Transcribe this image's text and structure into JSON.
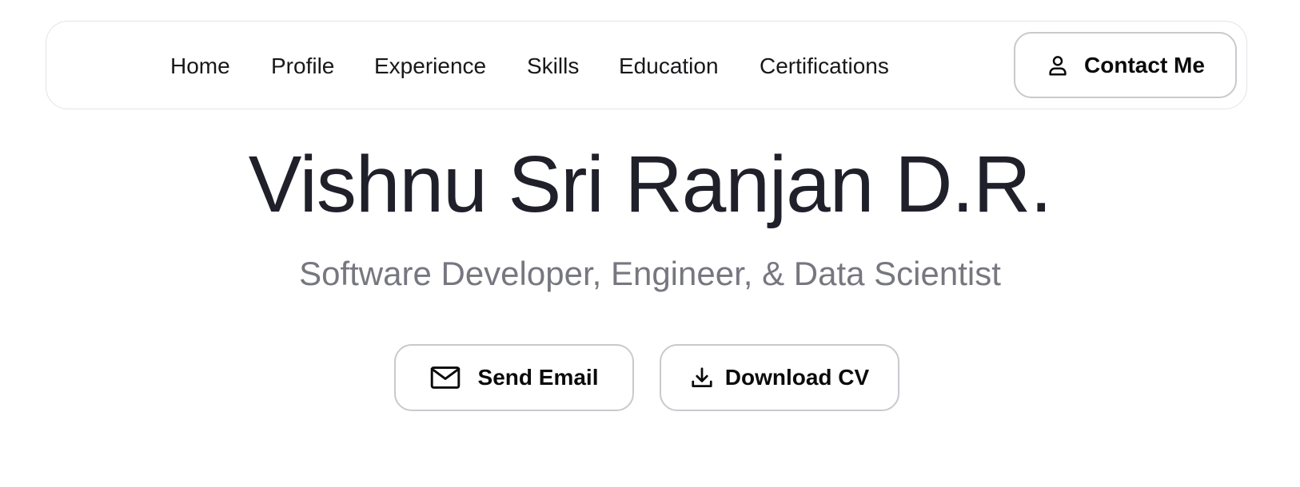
{
  "nav": {
    "items": [
      {
        "label": "Home",
        "name": "nav-home"
      },
      {
        "label": "Profile",
        "name": "nav-profile"
      },
      {
        "label": "Experience",
        "name": "nav-experience"
      },
      {
        "label": "Skills",
        "name": "nav-skills"
      },
      {
        "label": "Education",
        "name": "nav-education"
      },
      {
        "label": "Certifications",
        "name": "nav-certifications"
      }
    ],
    "contact_label": "Contact Me",
    "contact_icon": "user-icon"
  },
  "hero": {
    "title": "Vishnu Sri Ranjan D.R.",
    "subtitle": "Software Developer, Engineer, & Data Scientist"
  },
  "actions": {
    "send_email_label": "Send Email",
    "send_email_icon": "mail-icon",
    "download_cv_label": "Download CV",
    "download_cv_icon": "download-icon"
  },
  "colors": {
    "text_primary": "#1f2029",
    "text_muted": "#777780",
    "border": "#c9c9ce",
    "background": "#ffffff"
  }
}
